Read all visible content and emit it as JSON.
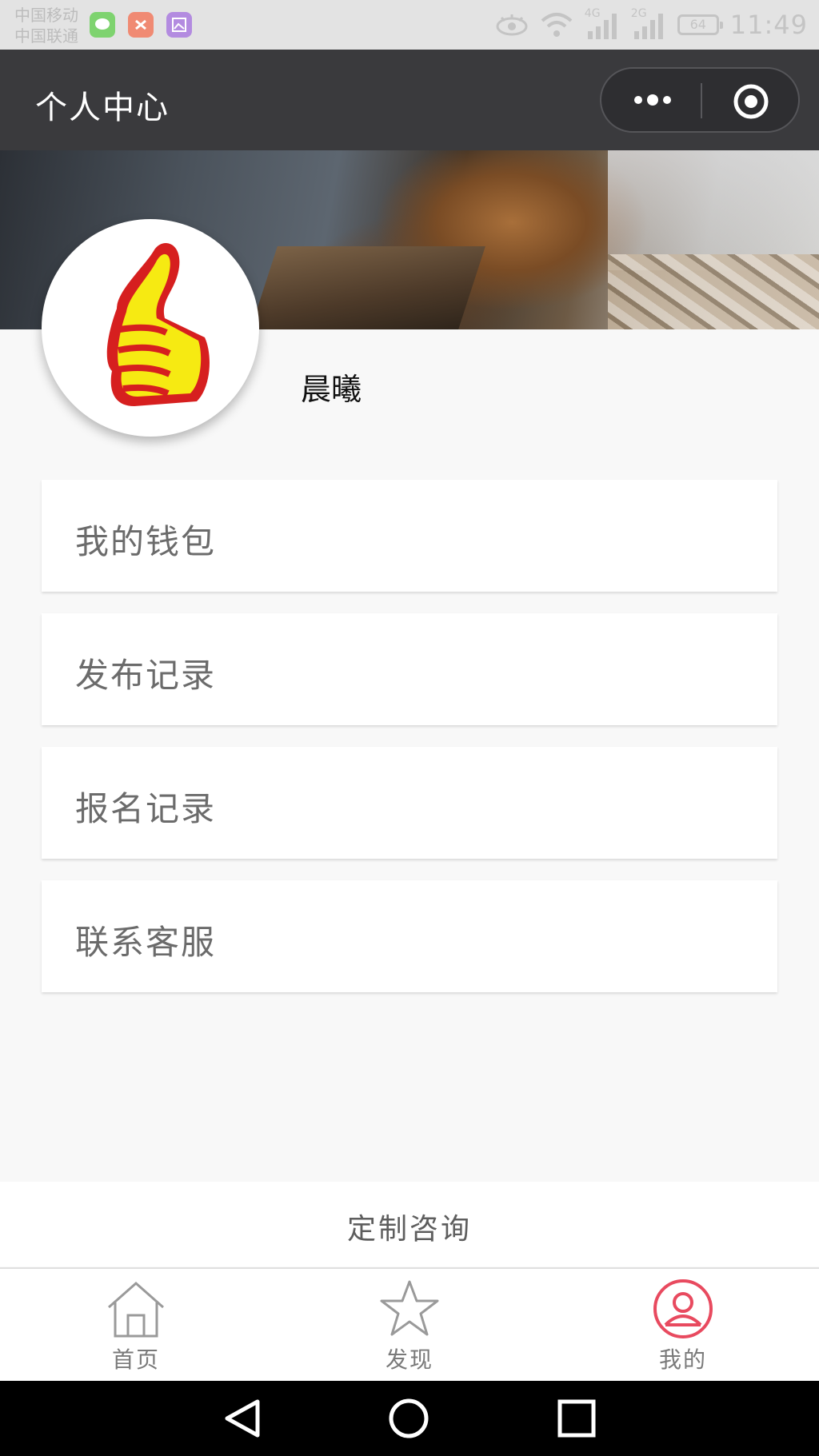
{
  "status_bar": {
    "carrier_1": "中国移动",
    "carrier_2": "中国联通",
    "network_1": "4G",
    "network_2": "2G",
    "battery": "64",
    "time": "11:49"
  },
  "nav_bar": {
    "title": "个人中心"
  },
  "profile": {
    "username": "晨曦"
  },
  "menu": {
    "items": [
      {
        "label": "我的钱包"
      },
      {
        "label": "发布记录"
      },
      {
        "label": "报名记录"
      },
      {
        "label": "联系客服"
      }
    ]
  },
  "consult": {
    "label": "定制咨询"
  },
  "tab_bar": {
    "tabs": [
      {
        "label": "首页",
        "icon": "home-icon"
      },
      {
        "label": "发现",
        "icon": "star-icon"
      },
      {
        "label": "我的",
        "icon": "user-icon",
        "active": true
      }
    ],
    "active_color": "#e84a5f"
  }
}
